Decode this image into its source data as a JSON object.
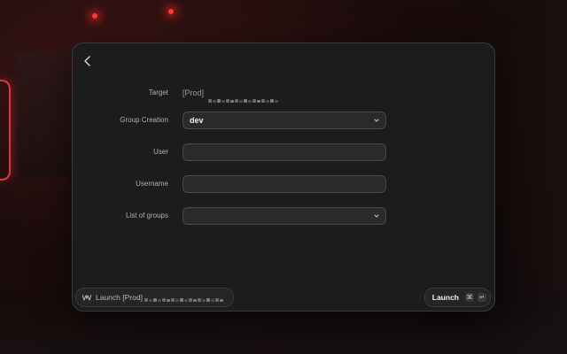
{
  "dialog": {
    "back_icon": "chevron-left-icon",
    "fields": {
      "target": {
        "label": "Target",
        "value": "[Prod]"
      },
      "group_creation": {
        "label": "Group Creation",
        "value": "dev"
      },
      "user": {
        "label": "User",
        "value": ""
      },
      "username": {
        "label": "Username",
        "value": ""
      },
      "list_of_groups": {
        "label": "List of groups",
        "value": ""
      }
    }
  },
  "footer": {
    "launch_context_text": "Launch [Prod]",
    "launch_button": "Launch",
    "shortcut_keys": [
      "⌘",
      "↵"
    ]
  }
}
